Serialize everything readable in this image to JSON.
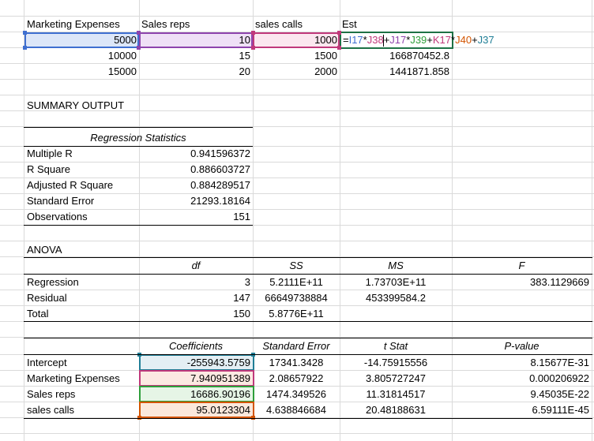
{
  "colors": {
    "blue": "#3f6fd0",
    "purple": "#8e44ad",
    "pink": "#c0397b",
    "green": "#2e9e3a",
    "orange": "#d35400",
    "teal": "#1f7e96"
  },
  "top_table": {
    "headers": [
      "Marketing Expenses",
      "Sales reps",
      "sales calls",
      "Est"
    ],
    "rows": [
      {
        "mkt": "5000",
        "reps": "10",
        "calls": "1000"
      },
      {
        "mkt": "10000",
        "reps": "15",
        "calls": "1500",
        "est": "166870452.8"
      },
      {
        "mkt": "15000",
        "reps": "20",
        "calls": "2000",
        "est": "1441871.858"
      }
    ],
    "formula_parts": [
      "=",
      "I17",
      "*",
      "J38",
      "+",
      "J17",
      "*",
      "J39",
      "+",
      "K17",
      "*",
      "J40",
      "+",
      "J37"
    ]
  },
  "summary_title": "SUMMARY OUTPUT",
  "regression_statistics": {
    "header": "Regression Statistics",
    "rows": [
      {
        "label": "Multiple R",
        "value": "0.941596372"
      },
      {
        "label": "R Square",
        "value": "0.886603727"
      },
      {
        "label": "Adjusted R Square",
        "value": "0.884289517"
      },
      {
        "label": "Standard Error",
        "value": "21293.18164"
      },
      {
        "label": "Observations",
        "value": "151"
      }
    ]
  },
  "anova": {
    "title": "ANOVA",
    "headers": [
      "df",
      "SS",
      "MS",
      "F"
    ],
    "rows": [
      {
        "label": "Regression",
        "df": "3",
        "ss": "5.2111E+11",
        "ms": "1.73703E+11",
        "f": "383.1129669"
      },
      {
        "label": "Residual",
        "df": "147",
        "ss": "66649738884",
        "ms": "453399584.2",
        "f": ""
      },
      {
        "label": "Total",
        "df": "150",
        "ss": "5.8776E+11",
        "ms": "",
        "f": ""
      }
    ]
  },
  "coefficients": {
    "headers": [
      "Coefficients",
      "Standard Error",
      "t Stat",
      "P-value"
    ],
    "rows": [
      {
        "label": "Intercept",
        "coef": "-255943.5759",
        "se": "17341.3428",
        "t": "-14.75915556",
        "p": "8.15677E-31"
      },
      {
        "label": "Marketing Expenses",
        "coef": "7.940951389",
        "se": "2.08657922",
        "t": "3.805727247",
        "p": "0.000206922"
      },
      {
        "label": "Sales reps",
        "coef": "16686.90196",
        "se": "1474.349526",
        "t": "11.31814517",
        "p": "9.45035E-22"
      },
      {
        "label": "sales calls",
        "coef": "95.0123304",
        "se": "4.638846684",
        "t": "20.48188631",
        "p": "6.59111E-45"
      }
    ]
  }
}
